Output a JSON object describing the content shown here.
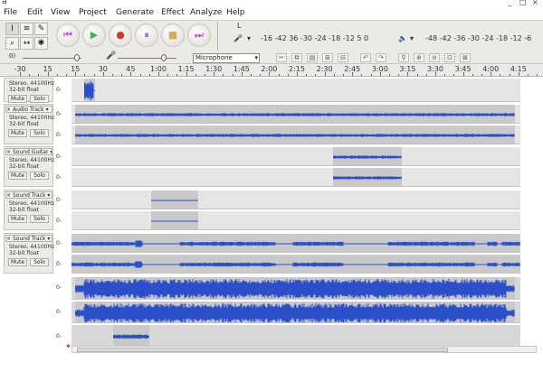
{
  "window": {
    "minimize": "_",
    "maximize": "□",
    "close": "×"
  },
  "menu": [
    "File",
    "Edit",
    "View",
    "Project",
    "Generate",
    "Effect",
    "Analyze",
    "Help"
  ],
  "tools": {
    "selection": "I",
    "envelope": "≋",
    "draw": "✎",
    "zoom": "⌕",
    "timeshift": "↔",
    "multi": "✱"
  },
  "transport": {
    "pause": "⏸",
    "play": "▶",
    "stop": "■",
    "skip_start": "⏮",
    "skip_end": "⏭",
    "record": "●"
  },
  "meters": {
    "input_label": "L",
    "input_scale": "-16 -42 36 -30 -24 -18 -12 5 0",
    "output_scale": "-48 -42 -36 -30 -24 -18 -12 -6"
  },
  "editbar": {
    "input_device": "Microphone",
    "gain_label": "0)"
  },
  "ruler": {
    "labels": [
      "-30",
      "15",
      "15",
      "30",
      "45",
      "1:00",
      "1:15",
      "1:30",
      "1:45",
      "2:00",
      "2:15",
      "2:30",
      "2:45",
      "3:00",
      "3:15",
      "3:30",
      "3:45",
      "4:00",
      "4:15"
    ]
  },
  "tracks": [
    {
      "title": "",
      "lines": [
        "Stereo, 44100Hz",
        "32-bit float"
      ],
      "mute": "Mute",
      "solo": "Solo"
    },
    {
      "title": "Audio Track",
      "lines": [
        "Stereo, 44100Hz",
        "32-bit float"
      ],
      "mute": "Mute",
      "solo": "Solo"
    },
    {
      "title": "Sound Guitar",
      "lines": [
        "Stereo, 44100Hz",
        "32-bit float"
      ],
      "mute": "Mute",
      "solo": "Solo"
    },
    {
      "title": "Sound Track",
      "lines": [
        "Stereo, 44100Hz",
        "32-bit float"
      ],
      "mute": "Mute",
      "solo": "Solo"
    },
    {
      "title": "Sound Track",
      "lines": [
        "Stereo, 44100Hz",
        "32-bit float"
      ],
      "mute": "Mute",
      "solo": "Solo"
    }
  ],
  "scale_zero": "0-"
}
